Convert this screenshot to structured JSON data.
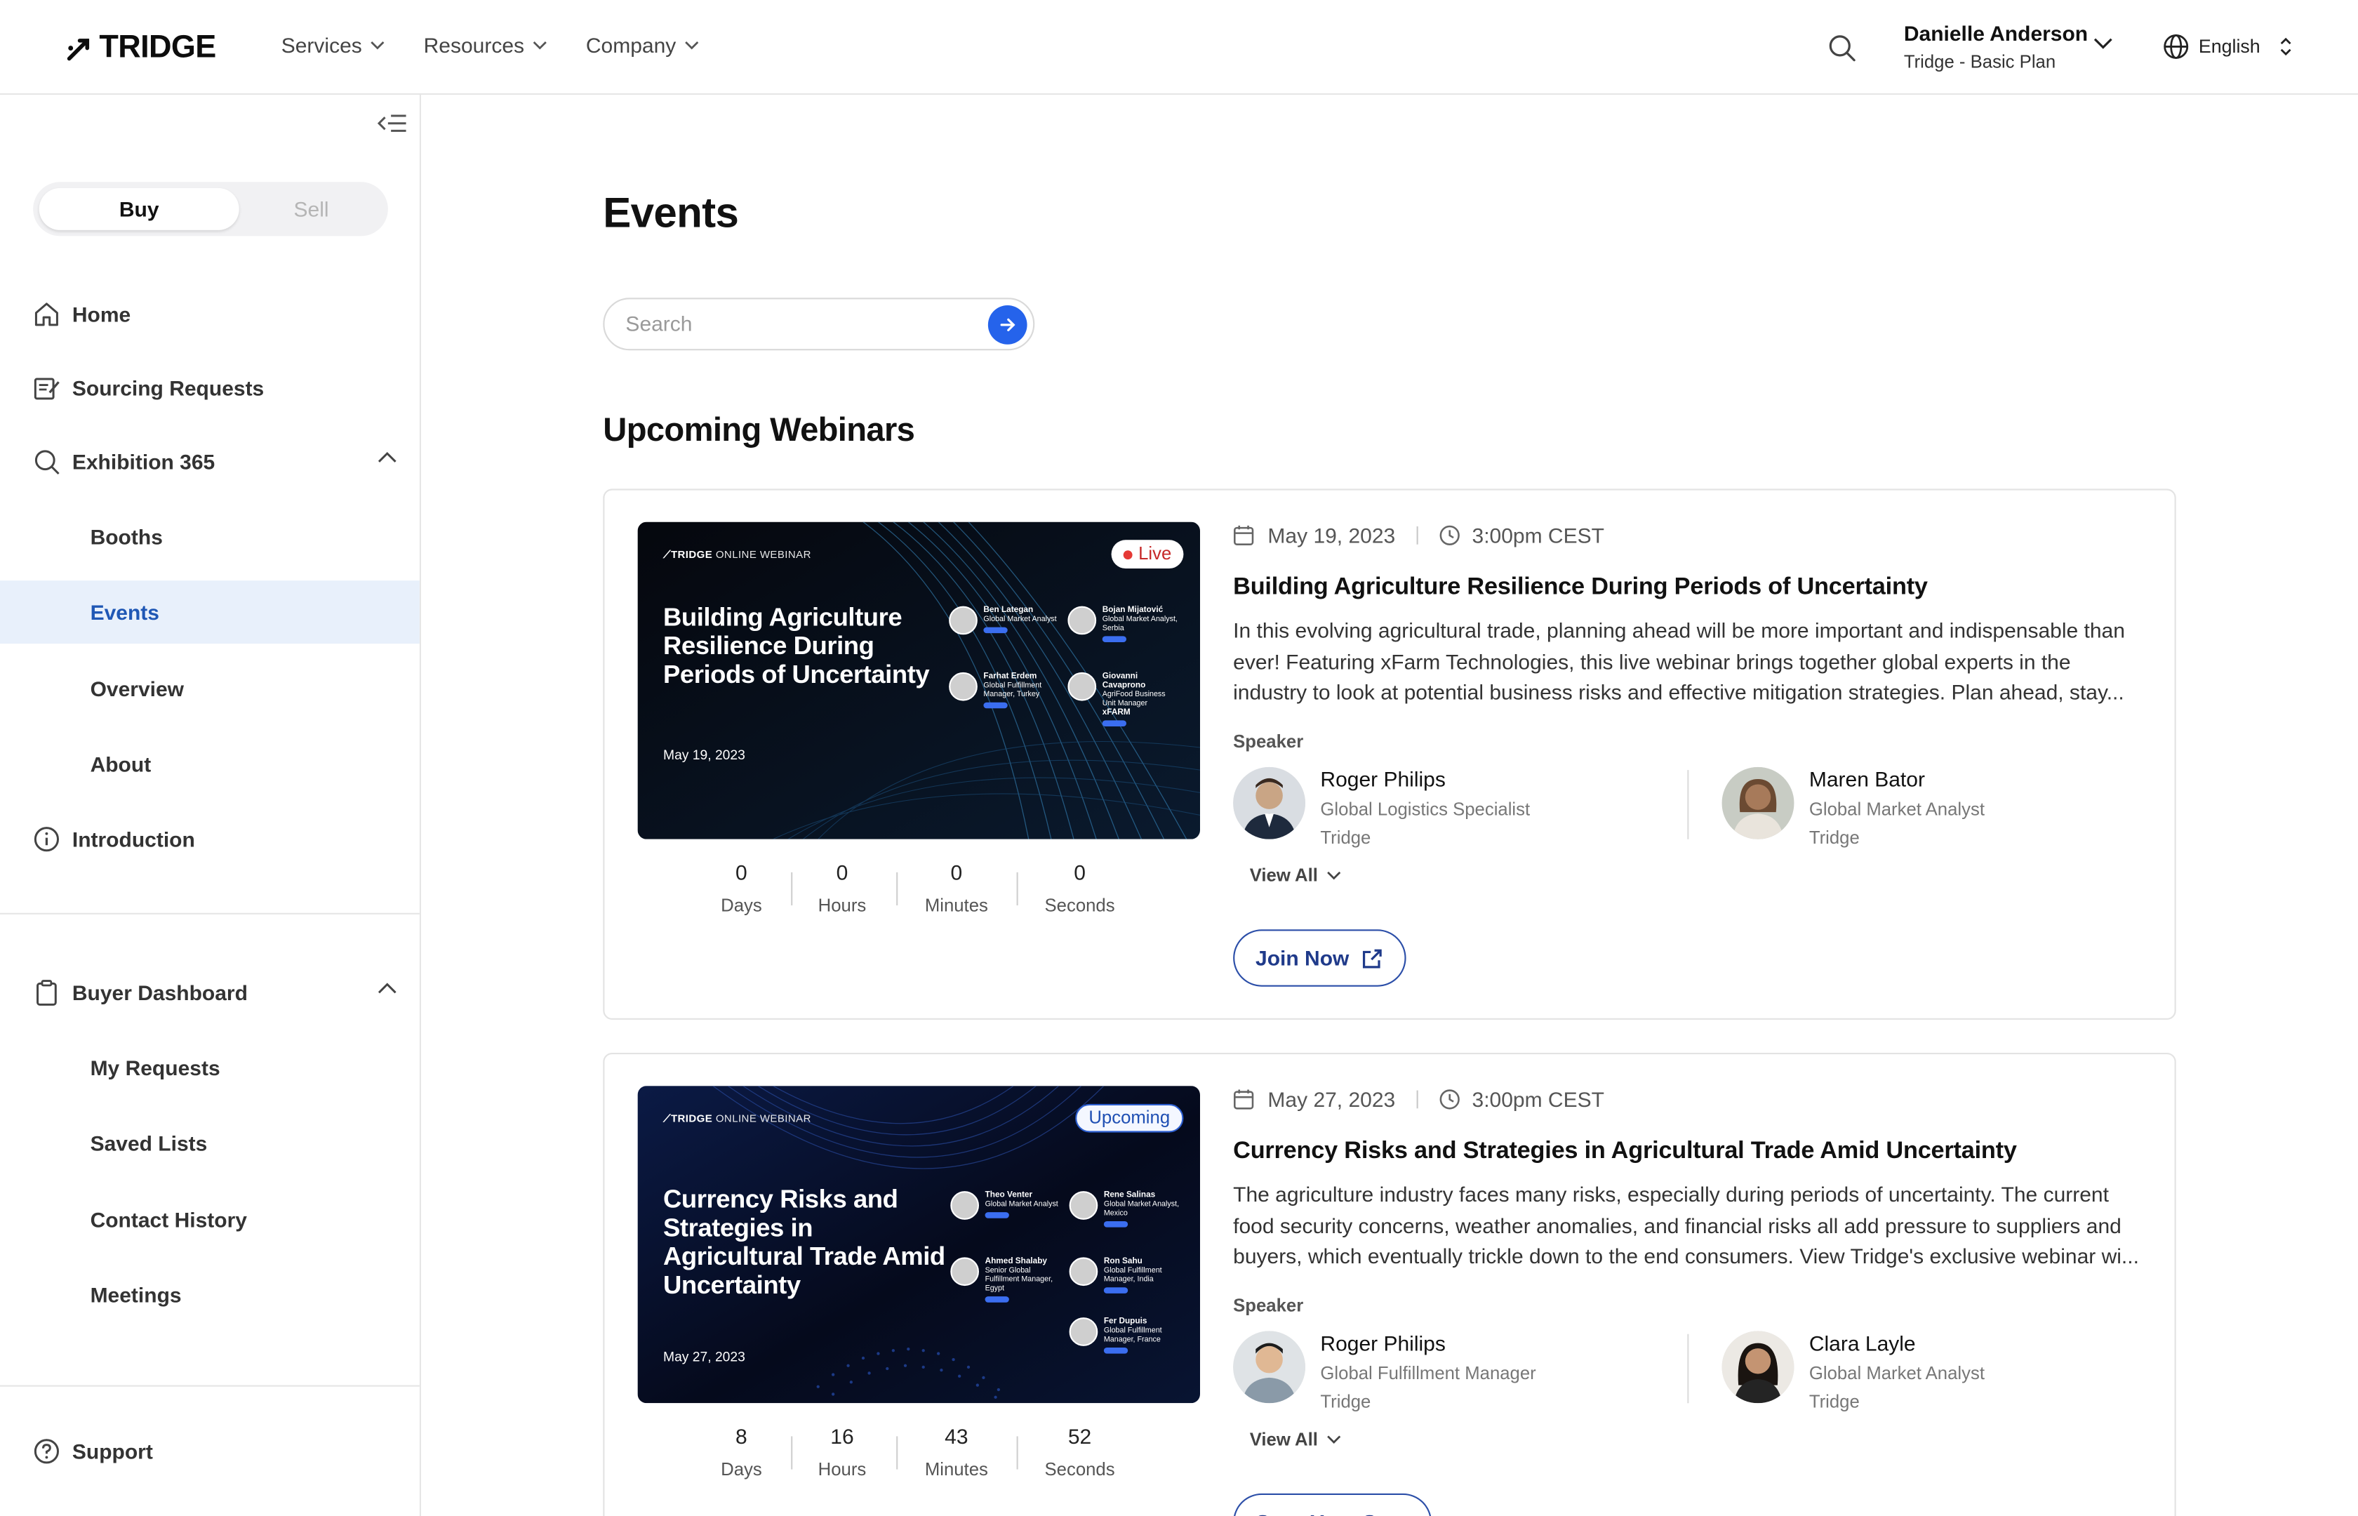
{
  "topbar": {
    "logo": "TRIDGE",
    "nav": [
      "Services",
      "Resources",
      "Company"
    ],
    "user_name": "Danielle Anderson",
    "user_plan": "Tridge - Basic Plan",
    "language": "English"
  },
  "sidebar": {
    "toggle": {
      "buy": "Buy",
      "sell": "Sell"
    },
    "home": "Home",
    "sourcing": "Sourcing Requests",
    "exhibition": "Exhibition 365",
    "booths": "Booths",
    "events": "Events",
    "overview": "Overview",
    "about": "About",
    "introduction": "Introduction",
    "buyer_dashboard": "Buyer Dashboard",
    "my_requests": "My Requests",
    "saved_lists": "Saved Lists",
    "contact_history": "Contact History",
    "meetings": "Meetings",
    "support": "Support"
  },
  "main": {
    "title": "Events",
    "search_placeholder": "Search",
    "section_title": "Upcoming Webinars",
    "cards": [
      {
        "status": "Live",
        "thumb_brand": "TRIDGE",
        "thumb_brand_sub": "ONLINE WEBINAR",
        "thumb_title": "Building Agriculture Resilience During Periods of Uncertainty",
        "thumb_date": "May 19, 2023",
        "thumb_speakers": [
          {
            "name": "Ben Lategan",
            "role": "Global Market Analyst"
          },
          {
            "name": "Bojan Mijatović",
            "role": "Global Market Analyst, Serbia"
          },
          {
            "name": "Farhat Erdem",
            "role": "Global Fulfillment Manager, Turkey"
          },
          {
            "name": "Giovanni Cavaprono",
            "role": "AgriFood Business Unit Manager",
            "company": "xFARM"
          }
        ],
        "countdown": {
          "days": "0",
          "hours": "0",
          "minutes": "0",
          "seconds": "0"
        },
        "labels": {
          "days": "Days",
          "hours": "Hours",
          "minutes": "Minutes",
          "seconds": "Seconds"
        },
        "date": "May 19, 2023",
        "time": "3:00pm CEST",
        "title": "Building Agriculture Resilience During Periods of Uncertainty",
        "description": "In this evolving agricultural trade, planning ahead will be more important and indispensable than ever! Featuring xFarm Technologies, this live webinar brings together global experts in the industry to look at potential business risks and effective mitigation strategies. Plan ahead, stay...",
        "speaker_label": "Speaker",
        "speakers": [
          {
            "name": "Roger Philips",
            "role": "Global Logistics Specialist",
            "company": "Tridge"
          },
          {
            "name": "Maren Bator",
            "role": "Global Market Analyst",
            "company": "Tridge"
          }
        ],
        "view_all": "View All",
        "action": "Join Now"
      },
      {
        "status": "Upcoming",
        "thumb_brand": "TRIDGE",
        "thumb_brand_sub": "ONLINE WEBINAR",
        "thumb_title": "Currency Risks and Strategies in Agricultural Trade Amid Uncertainty",
        "thumb_date": "May 27, 2023",
        "thumb_speakers": [
          {
            "name": "Theo Venter",
            "role": "Global Market Analyst"
          },
          {
            "name": "Rene Salinas",
            "role": "Global Market Analyst, Mexico"
          },
          {
            "name": "Ahmed Shalaby",
            "role": "Senior Global Fulfillment Manager, Egypt"
          },
          {
            "name": "Ron Sahu",
            "role": "Global Fulfillment Manager, India"
          },
          {
            "name": "Fer Dupuis",
            "role": "Global Fulfillment Manager, France"
          }
        ],
        "countdown": {
          "days": "8",
          "hours": "16",
          "minutes": "43",
          "seconds": "52"
        },
        "labels": {
          "days": "Days",
          "hours": "Hours",
          "minutes": "Minutes",
          "seconds": "Seconds"
        },
        "date": "May 27, 2023",
        "time": "3:00pm CEST",
        "title": "Currency Risks and Strategies in Agricultural Trade Amid Uncertainty",
        "description": "The agriculture industry faces many risks, especially during periods of uncertainty. The current food security concerns, weather anomalies, and financial risks all add pressure to suppliers and buyers, which eventually trickle down to the end consumers. View Tridge's exclusive webinar wi...",
        "speaker_label": "Speaker",
        "speakers": [
          {
            "name": "Roger Philips",
            "role": "Global Fulfillment Manager",
            "company": "Tridge"
          },
          {
            "name": "Clara Layle",
            "role": "Global Market Analyst",
            "company": "Tridge"
          }
        ],
        "view_all": "View All",
        "action": "Save Your Spot"
      }
    ]
  },
  "colors": {
    "accent": "#2563eb",
    "active_bg": "#e8f0fb",
    "active_text": "#1f57b5",
    "live": "#e53935"
  }
}
